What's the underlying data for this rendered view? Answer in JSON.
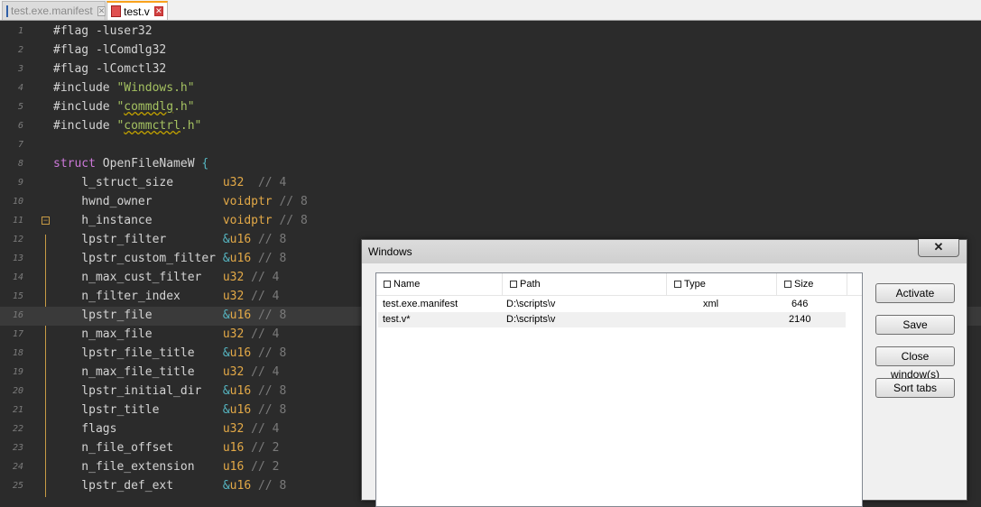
{
  "tabs": [
    {
      "label": "test.exe.manifest",
      "active": false
    },
    {
      "label": "test.v",
      "active": true
    }
  ],
  "editor": {
    "lines": [
      {
        "n": "1",
        "parts": [
          [
            "",
            "#flag -luser32"
          ]
        ]
      },
      {
        "n": "2",
        "parts": [
          [
            "",
            "#flag -lComdlg32"
          ]
        ]
      },
      {
        "n": "3",
        "parts": [
          [
            "",
            "#flag -lComctl32"
          ]
        ]
      },
      {
        "n": "4",
        "parts": [
          [
            "",
            "#include "
          ],
          [
            "str",
            "\"Windows.h\""
          ]
        ]
      },
      {
        "n": "5",
        "parts": [
          [
            "",
            "#include "
          ],
          [
            "str",
            "\""
          ],
          [
            "str sq",
            "commdlg"
          ],
          [
            "str",
            ".h\""
          ]
        ]
      },
      {
        "n": "6",
        "parts": [
          [
            "",
            "#include "
          ],
          [
            "str",
            "\""
          ],
          [
            "str sq",
            "commctrl"
          ],
          [
            "str",
            ".h\""
          ]
        ]
      },
      {
        "n": "7",
        "parts": []
      },
      {
        "n": "8",
        "parts": [
          [
            "kw",
            "struct"
          ],
          [
            "",
            " OpenFileNameW "
          ],
          [
            "op",
            "{"
          ]
        ]
      },
      {
        "n": "9",
        "parts": [
          [
            "",
            "    l_struct_size       "
          ],
          [
            "typ",
            "u32"
          ],
          [
            "cmt",
            "  // 4"
          ]
        ]
      },
      {
        "n": "10",
        "parts": [
          [
            "",
            "    hwnd_owner          "
          ],
          [
            "typ",
            "voidptr"
          ],
          [
            "cmt",
            " // 8"
          ]
        ]
      },
      {
        "n": "11",
        "parts": [
          [
            "",
            "    h_instance          "
          ],
          [
            "typ",
            "voidptr"
          ],
          [
            "cmt",
            " // 8"
          ]
        ]
      },
      {
        "n": "12",
        "parts": [
          [
            "",
            "    lpstr_filter        "
          ],
          [
            "op",
            "&"
          ],
          [
            "typ",
            "u16"
          ],
          [
            "cmt",
            " // 8"
          ]
        ]
      },
      {
        "n": "13",
        "parts": [
          [
            "",
            "    lpstr_custom_filter "
          ],
          [
            "op",
            "&"
          ],
          [
            "typ",
            "u16"
          ],
          [
            "cmt",
            " // 8"
          ]
        ]
      },
      {
        "n": "14",
        "parts": [
          [
            "",
            "    n_max_cust_filter   "
          ],
          [
            "typ",
            "u32"
          ],
          [
            "cmt",
            " // 4"
          ]
        ]
      },
      {
        "n": "15",
        "parts": [
          [
            "",
            "    n_filter_index      "
          ],
          [
            "typ",
            "u32"
          ],
          [
            "cmt",
            " // 4"
          ]
        ]
      },
      {
        "n": "16",
        "parts": [
          [
            "",
            "    lpstr_file          "
          ],
          [
            "op",
            "&"
          ],
          [
            "typ",
            "u16"
          ],
          [
            "cmt",
            " // 8"
          ]
        ]
      },
      {
        "n": "17",
        "parts": [
          [
            "",
            "    n_max_file          "
          ],
          [
            "typ",
            "u32"
          ],
          [
            "cmt",
            " // 4"
          ]
        ]
      },
      {
        "n": "18",
        "parts": [
          [
            "",
            "    lpstr_file_title    "
          ],
          [
            "op",
            "&"
          ],
          [
            "typ",
            "u16"
          ],
          [
            "cmt",
            " // 8"
          ]
        ]
      },
      {
        "n": "19",
        "parts": [
          [
            "",
            "    n_max_file_title    "
          ],
          [
            "typ",
            "u32"
          ],
          [
            "cmt",
            " // 4"
          ]
        ]
      },
      {
        "n": "20",
        "parts": [
          [
            "",
            "    lpstr_initial_dir   "
          ],
          [
            "op",
            "&"
          ],
          [
            "typ",
            "u16"
          ],
          [
            "cmt",
            " // 8"
          ]
        ]
      },
      {
        "n": "21",
        "parts": [
          [
            "",
            "    lpstr_title         "
          ],
          [
            "op",
            "&"
          ],
          [
            "typ",
            "u16"
          ],
          [
            "cmt",
            " // 8"
          ]
        ]
      },
      {
        "n": "22",
        "parts": [
          [
            "",
            "    flags               "
          ],
          [
            "typ",
            "u32"
          ],
          [
            "cmt",
            " // 4"
          ]
        ]
      },
      {
        "n": "23",
        "parts": [
          [
            "",
            "    n_file_offset       "
          ],
          [
            "typ",
            "u16"
          ],
          [
            "cmt",
            " // 2"
          ]
        ]
      },
      {
        "n": "24",
        "parts": [
          [
            "",
            "    n_file_extension    "
          ],
          [
            "typ",
            "u16"
          ],
          [
            "cmt",
            " // 2"
          ]
        ]
      },
      {
        "n": "25",
        "parts": [
          [
            "",
            "    lpstr_def_ext       "
          ],
          [
            "op",
            "&"
          ],
          [
            "typ",
            "u16"
          ],
          [
            "cmt",
            " // 8"
          ]
        ]
      }
    ]
  },
  "dialog": {
    "title": "Windows",
    "close_glyph": "✕",
    "columns": [
      "Name",
      "Path",
      "Type",
      "Size"
    ],
    "rows": [
      {
        "name": "test.exe.manifest",
        "path": "D:\\scripts\\v",
        "type": "xml",
        "size": "646"
      },
      {
        "name": "test.v*",
        "path": "D:\\scripts\\v",
        "type": "",
        "size": "2140"
      }
    ],
    "buttons": {
      "activate": "Activate",
      "save": "Save",
      "close_windows": "Close window(s)",
      "sort_tabs": "Sort tabs"
    }
  },
  "colors": {
    "active_tab_accent": "#f9a21c",
    "editor_bg": "#2b2b2b",
    "keyword": "#cc78d8",
    "string": "#a5c261",
    "type": "#e3a947"
  }
}
